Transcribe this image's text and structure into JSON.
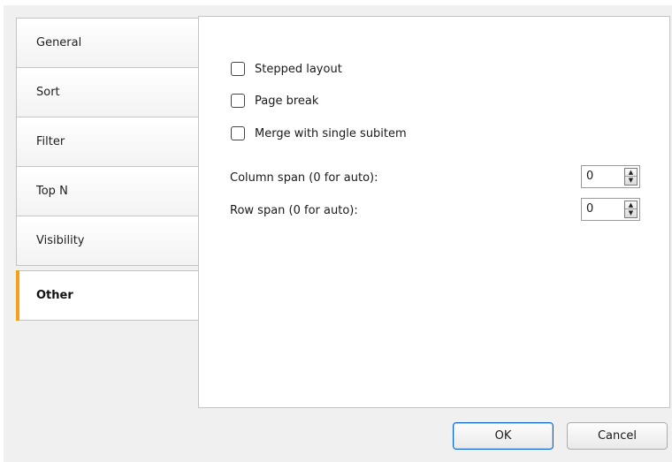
{
  "tabs": [
    {
      "label": "General",
      "active": false
    },
    {
      "label": "Sort",
      "active": false
    },
    {
      "label": "Filter",
      "active": false
    },
    {
      "label": "Top N",
      "active": false
    },
    {
      "label": "Visibility",
      "active": false
    },
    {
      "label": "Other",
      "active": true
    }
  ],
  "options": {
    "stepped_layout": {
      "label": "Stepped layout",
      "checked": false
    },
    "page_break": {
      "label": "Page break",
      "checked": false
    },
    "merge_single": {
      "label": "Merge with single subitem",
      "checked": false
    }
  },
  "fields": {
    "column_span": {
      "label": "Column span (0 for auto):",
      "value": "0"
    },
    "row_span": {
      "label": "Row span (0 for auto):",
      "value": "0"
    }
  },
  "buttons": {
    "ok": "OK",
    "cancel": "Cancel"
  },
  "colors": {
    "active_tab_accent": "#f4a11a",
    "default_button_border": "#0a64c8"
  }
}
